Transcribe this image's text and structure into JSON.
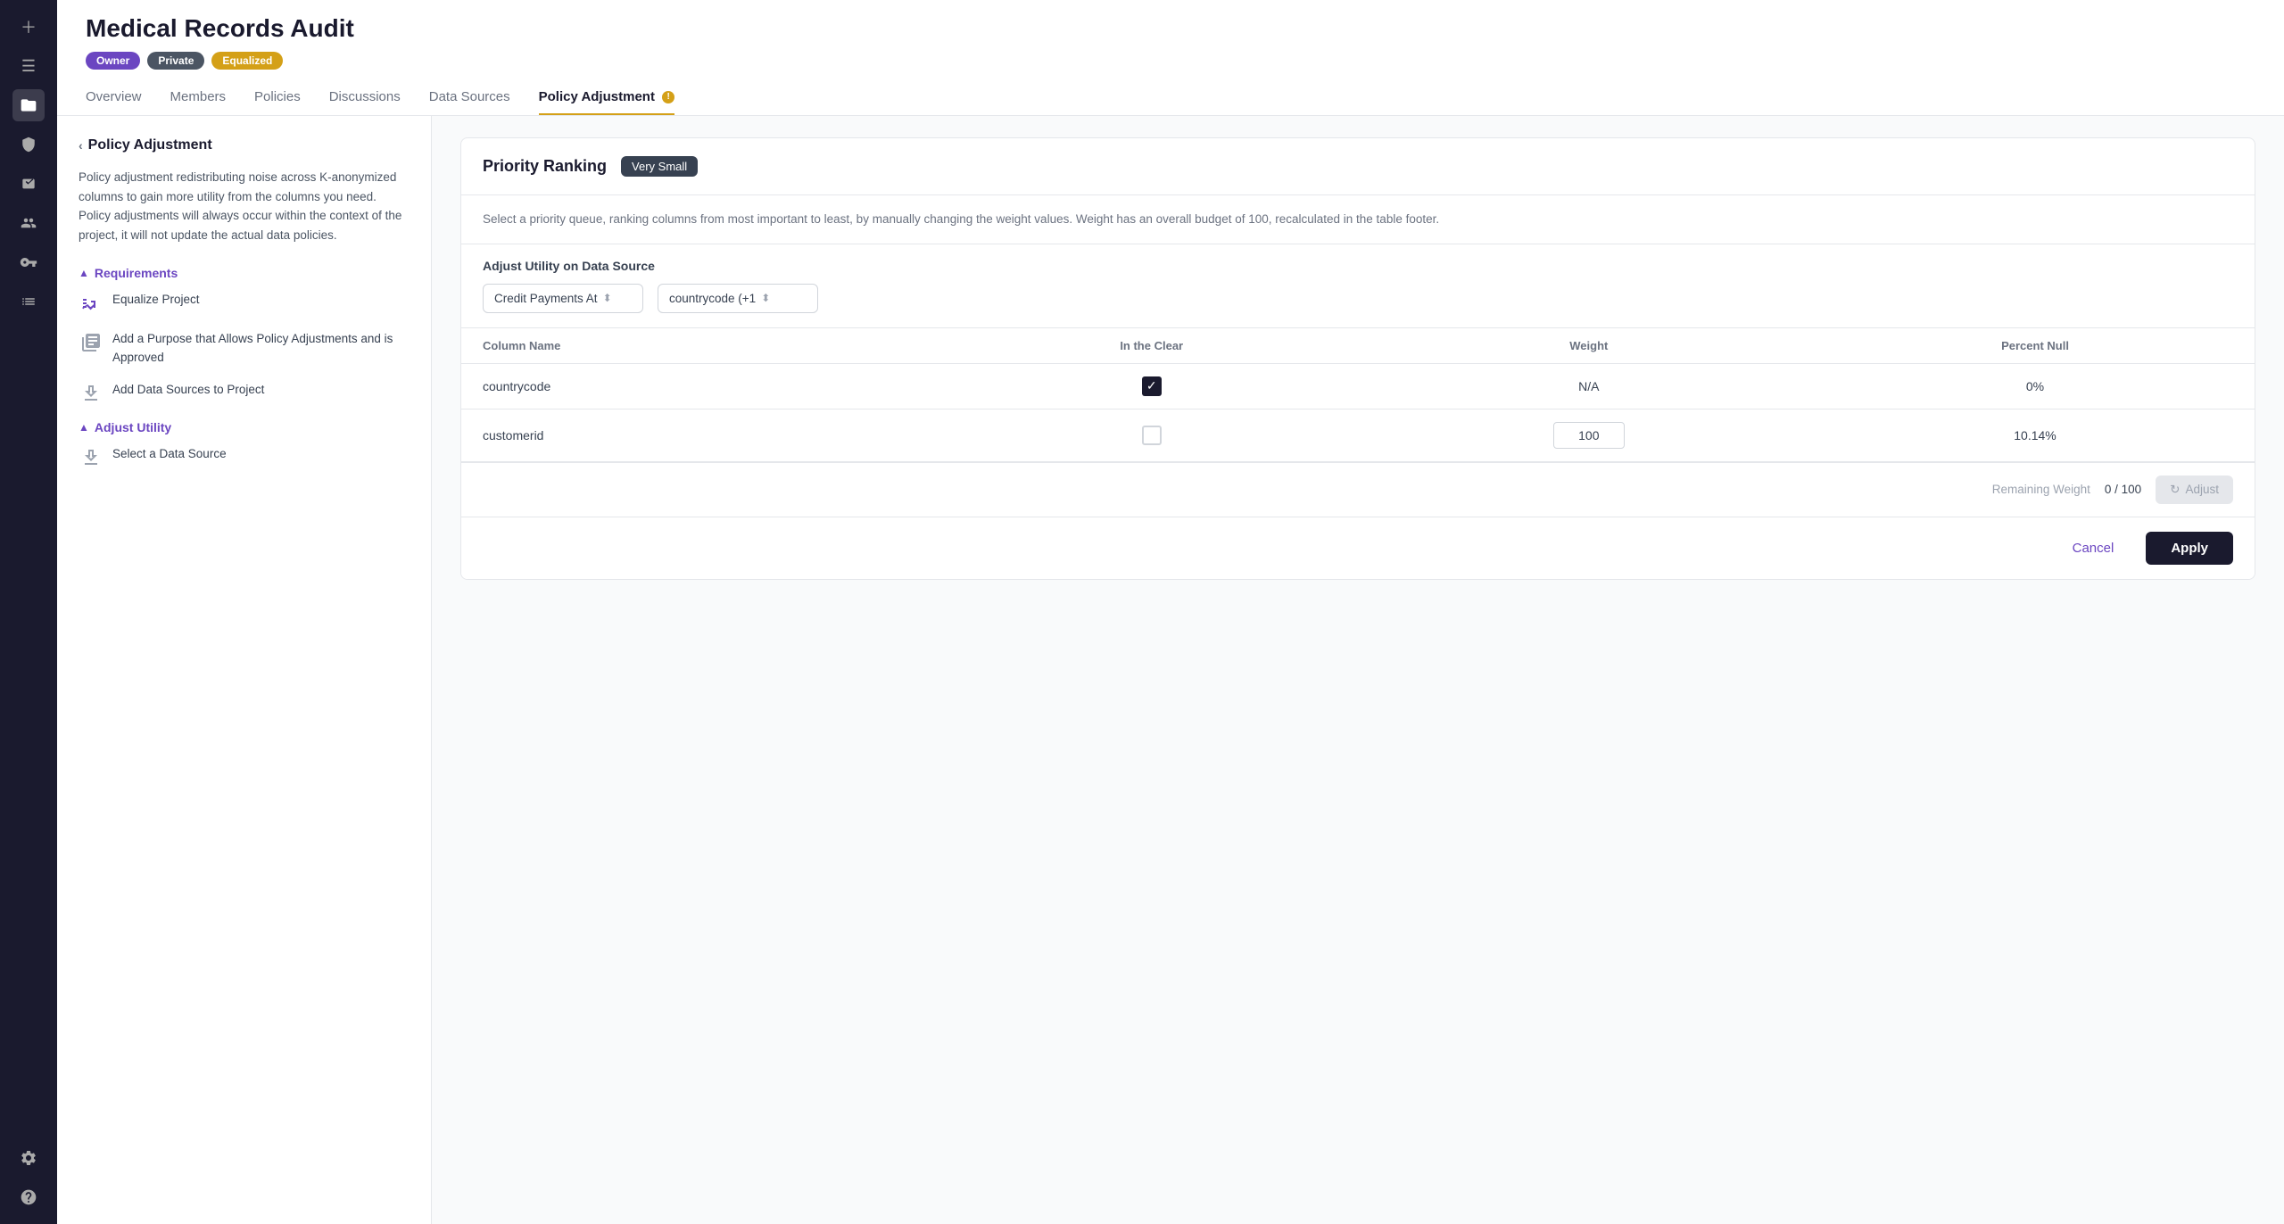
{
  "sidebar": {
    "icons": [
      {
        "name": "add-icon",
        "symbol": "＋",
        "active": false
      },
      {
        "name": "layers-icon",
        "symbol": "≡",
        "active": false
      },
      {
        "name": "folder-icon",
        "symbol": "📁",
        "active": true
      },
      {
        "name": "shield-icon",
        "symbol": "🛡",
        "active": false
      },
      {
        "name": "terminal-icon",
        "symbol": ">_",
        "active": false
      },
      {
        "name": "users-icon",
        "symbol": "👥",
        "active": false
      },
      {
        "name": "key-icon",
        "symbol": "🔑",
        "active": false
      },
      {
        "name": "list-icon",
        "symbol": "📋",
        "active": false
      },
      {
        "name": "settings-icon",
        "symbol": "⚙",
        "active": false
      },
      {
        "name": "help-icon",
        "symbol": "?",
        "active": false
      }
    ]
  },
  "header": {
    "project_title": "Medical Records Audit",
    "tags": [
      {
        "label": "Owner",
        "type": "owner"
      },
      {
        "label": "Private",
        "type": "private"
      },
      {
        "label": "Equalized",
        "type": "equalized"
      }
    ],
    "nav_tabs": [
      {
        "label": "Overview",
        "active": false
      },
      {
        "label": "Members",
        "active": false
      },
      {
        "label": "Policies",
        "active": false
      },
      {
        "label": "Discussions",
        "active": false
      },
      {
        "label": "Data Sources",
        "active": false
      },
      {
        "label": "Policy Adjustment",
        "active": true,
        "has_dot": true
      }
    ]
  },
  "left_panel": {
    "back_label": "Policy Adjustment",
    "description": "Policy adjustment redistributing noise across K-anonymized columns to gain more utility from the columns you need. Policy adjustments will always occur within the context of the project, it will not update the actual data policies.",
    "requirements_label": "Requirements",
    "requirements": [
      {
        "name": "equalize-project",
        "icon": "📊",
        "text": "Equalize Project",
        "checked": true
      },
      {
        "name": "add-purpose",
        "icon": "🏛",
        "text": "Add a Purpose that Allows Policy Adjustments and is Approved",
        "checked": false
      },
      {
        "name": "add-data-sources",
        "icon": "📤",
        "text": "Add Data Sources to Project",
        "checked": false
      }
    ],
    "adjust_utility_label": "Adjust Utility",
    "adjust_utility_items": [
      {
        "name": "select-data-source",
        "icon": "📤",
        "text": "Select a Data Source",
        "checked": false
      }
    ]
  },
  "main": {
    "card": {
      "title": "Priority Ranking",
      "badge": "Very Small",
      "description": "Select a priority queue, ranking columns from most important to least, by manually changing the weight values. Weight has an overall budget of 100, recalculated in the table footer.",
      "ds_label": "Adjust Utility on Data Source",
      "ds_selector1": "Credit Payments At",
      "ds_selector2": "countrycode (+1",
      "table": {
        "columns": [
          "Column Name",
          "In the Clear",
          "Weight",
          "Percent Null"
        ],
        "rows": [
          {
            "column_name": "countrycode",
            "in_the_clear": true,
            "weight": "N/A",
            "percent_null": "0%"
          },
          {
            "column_name": "customerid",
            "in_the_clear": false,
            "weight": "100",
            "percent_null": "10.14%"
          }
        ]
      },
      "remaining_weight_label": "Remaining Weight",
      "remaining_weight_value": "0 / 100",
      "adjust_btn_label": "Adjust"
    },
    "cancel_label": "Cancel",
    "apply_label": "Apply"
  }
}
